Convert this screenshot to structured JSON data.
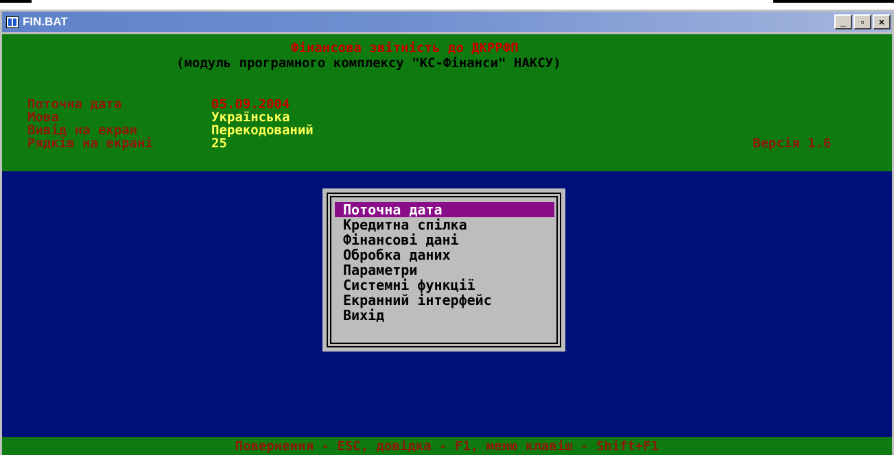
{
  "window": {
    "title": "FIN.BAT",
    "controls": [
      "_",
      "▫",
      "×"
    ]
  },
  "header": {
    "title": "Фінансова звітність до ДКРРФП",
    "subtitle": "(модуль програмного комплексу \"КС-Фінанси\" НАКСУ)",
    "fields": [
      {
        "label": "Поточна дата",
        "value": "05.09.2004"
      },
      {
        "label": "Мова",
        "value": "Українська"
      },
      {
        "label": "Вивід на екран",
        "value": "Перекодований"
      },
      {
        "label": "Рядків на екрані",
        "value": "25"
      }
    ],
    "version": "Версія 1.6"
  },
  "menu": {
    "items": [
      "Поточна дата",
      "Кредитна спілка",
      "Фінансові дані",
      "Обробка даних",
      "Параметри",
      "Системні функції",
      "Екранний інтерфейс",
      "Вихід"
    ],
    "selected_index": 0
  },
  "footer": {
    "hint": "Повернення - ESC, довідка - F1, меню клавіш - Shift+F1"
  },
  "colors": {
    "console_bg": "#00107a",
    "header_bg": "#0f7a0f",
    "menu_bg": "#bdbdbd",
    "menu_selected": "#8a0e8a",
    "title_red": "#c80000",
    "value_yellow": "#ffff55"
  }
}
